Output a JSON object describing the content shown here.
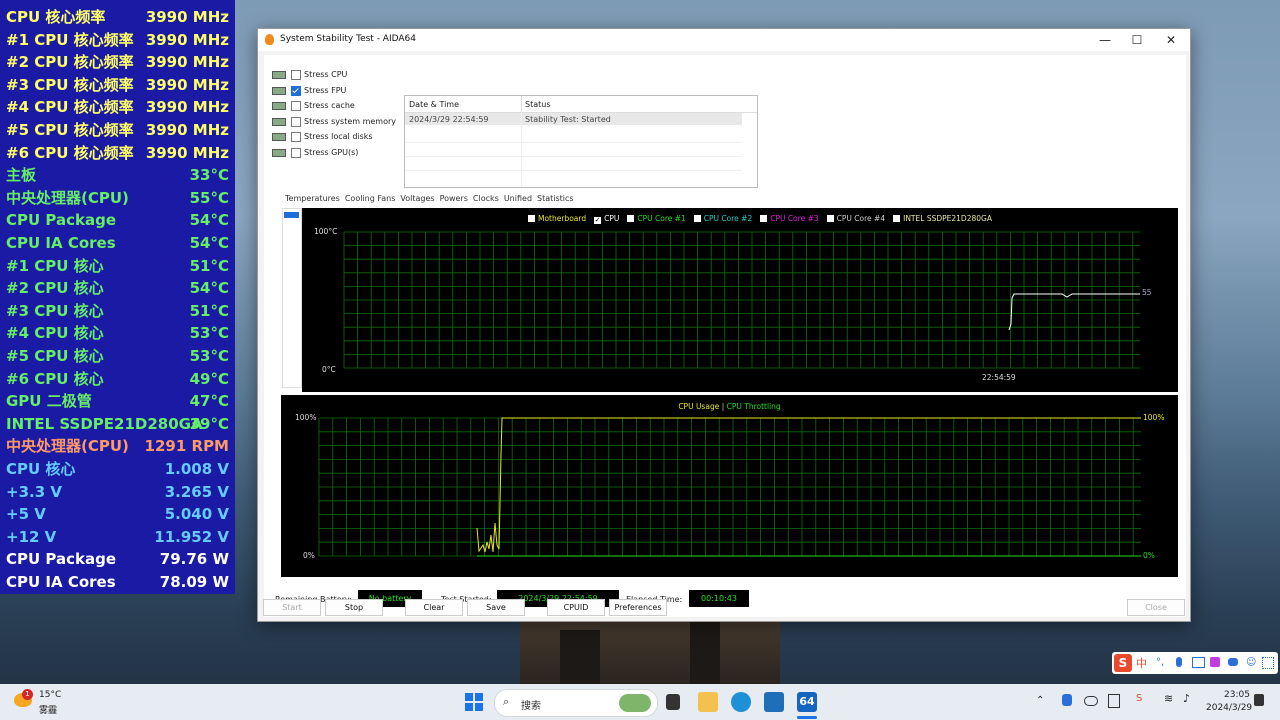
{
  "sensor_rows": [
    {
      "label": "CPU 核心频率",
      "value": "3990 MHz",
      "color": "#ffff66"
    },
    {
      "label": "#1 CPU 核心频率",
      "value": "3990 MHz",
      "color": "#ffff66"
    },
    {
      "label": "#2 CPU 核心频率",
      "value": "3990 MHz",
      "color": "#ffff66"
    },
    {
      "label": "#3 CPU 核心频率",
      "value": "3990 MHz",
      "color": "#ffff66"
    },
    {
      "label": "#4 CPU 核心频率",
      "value": "3990 MHz",
      "color": "#ffff66"
    },
    {
      "label": "#5 CPU 核心频率",
      "value": "3990 MHz",
      "color": "#ffff66"
    },
    {
      "label": "#6 CPU 核心频率",
      "value": "3990 MHz",
      "color": "#ffff66"
    },
    {
      "label": "主板",
      "value": "33°C",
      "color": "#66ee66"
    },
    {
      "label": "中央处理器(CPU)",
      "value": "55°C",
      "color": "#66ee66"
    },
    {
      "label": "CPU Package",
      "value": "54°C",
      "color": "#66ee66"
    },
    {
      "label": "CPU IA Cores",
      "value": "54°C",
      "color": "#66ee66"
    },
    {
      "label": " #1 CPU 核心",
      "value": "51°C",
      "color": "#66ee66"
    },
    {
      "label": " #2 CPU 核心",
      "value": "54°C",
      "color": "#66ee66"
    },
    {
      "label": " #3 CPU 核心",
      "value": "51°C",
      "color": "#66ee66"
    },
    {
      "label": " #4 CPU 核心",
      "value": "53°C",
      "color": "#66ee66"
    },
    {
      "label": " #5 CPU 核心",
      "value": "53°C",
      "color": "#66ee66"
    },
    {
      "label": " #6 CPU 核心",
      "value": "49°C",
      "color": "#66ee66"
    },
    {
      "label": "GPU 二极管",
      "value": "47°C",
      "color": "#66ee66"
    },
    {
      "label": "INTEL SSDPE21D280GA",
      "value": "39°C",
      "color": "#66ee66"
    },
    {
      "label": "中央处理器(CPU)",
      "value": "1291 RPM",
      "color": "#ff9966"
    },
    {
      "label": "CPU 核心",
      "value": "1.008 V",
      "color": "#66ccff"
    },
    {
      "label": "+3.3 V",
      "value": "3.265 V",
      "color": "#66ccff"
    },
    {
      "label": "+5 V",
      "value": "5.040 V",
      "color": "#66ccff"
    },
    {
      "label": "+12 V",
      "value": "11.952 V",
      "color": "#66ccff"
    },
    {
      "label": "CPU Package",
      "value": "79.76 W",
      "color": "#ffffff"
    },
    {
      "label": "CPU IA Cores",
      "value": "78.09 W",
      "color": "#ffffff"
    }
  ],
  "window": {
    "title": "System Stability Test - AIDA64",
    "minimize": "—",
    "maximize": "☐",
    "close": "✕"
  },
  "stress_options": [
    {
      "label": "Stress CPU",
      "checked": false
    },
    {
      "label": "Stress FPU",
      "checked": true
    },
    {
      "label": "Stress cache",
      "checked": false
    },
    {
      "label": "Stress system memory",
      "checked": false
    },
    {
      "label": "Stress local disks",
      "checked": false
    },
    {
      "label": "Stress GPU(s)",
      "checked": false
    }
  ],
  "status_table": {
    "col_datetime": "Date & Time",
    "col_status": "Status",
    "row_datetime": "2024/3/29 22:54:59",
    "row_status": "Stability Test: Started"
  },
  "tabs": [
    "Temperatures",
    "Cooling Fans",
    "Voltages",
    "Powers",
    "Clocks",
    "Unified",
    "Statistics"
  ],
  "temp_graph": {
    "legend": [
      {
        "label": "Motherboard",
        "checked": false,
        "color": "#e8e820"
      },
      {
        "label": "CPU",
        "checked": true,
        "color": "#ffffff"
      },
      {
        "label": "CPU Core #1",
        "checked": false,
        "color": "#22dd22"
      },
      {
        "label": "CPU Core #2",
        "checked": false,
        "color": "#22cccc"
      },
      {
        "label": "CPU Core #3",
        "checked": false,
        "color": "#dd22dd"
      },
      {
        "label": "CPU Core #4",
        "checked": false,
        "color": "#cccccc"
      },
      {
        "label": "INTEL SSDPE21D280GA",
        "checked": false,
        "color": "#e8e8a0"
      }
    ],
    "ymax_label": "100°C",
    "ymin_label": "0°C",
    "time_label": "22:54:59",
    "current_value": "55"
  },
  "usage_graph": {
    "title_usage": "CPU Usage",
    "separator": "|",
    "title_throttle": "CPU Throttling",
    "left_top": "100%",
    "left_bottom": "0%",
    "right_top": "100%",
    "right_bottom": "0%"
  },
  "footer": {
    "battery_label": "Remaining Battery:",
    "battery_value": "No battery",
    "started_label": "Test Started:",
    "started_value": "2024/3/29 22:54:59",
    "elapsed_label": "Elapsed Time:",
    "elapsed_value": "00:10:43"
  },
  "buttons": {
    "start": "Start",
    "stop": "Stop",
    "clear": "Clear",
    "save": "Save",
    "cpuid": "CPUID",
    "preferences": "Preferences",
    "close": "Close"
  },
  "ime": {
    "s": "S",
    "zh": "中"
  },
  "taskbar": {
    "weather_temp": "15°C",
    "weather_desc": "雾霾",
    "weather_badge": "1",
    "search_placeholder": "搜索",
    "aida_label": "64",
    "clock_time": "23:05",
    "clock_date": "2024/3/29"
  }
}
